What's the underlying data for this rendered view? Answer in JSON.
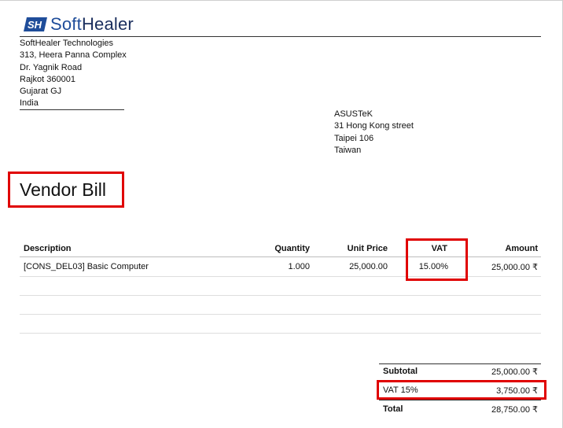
{
  "logo": {
    "mark": "SH",
    "name_part1": "Soft",
    "name_part2": "Healer"
  },
  "company": {
    "lines": [
      "SoftHealer Technologies",
      "313, Heera Panna Complex",
      "Dr. Yagnik Road",
      "Rajkot 360001",
      "Gujarat GJ",
      "India"
    ]
  },
  "vendor": {
    "lines": [
      "ASUSTeK",
      "31 Hong Kong street",
      "Taipei 106",
      "Taiwan"
    ]
  },
  "document_title": "Vendor Bill",
  "table": {
    "headers": {
      "description": "Description",
      "quantity": "Quantity",
      "unit_price": "Unit Price",
      "vat": "VAT",
      "amount": "Amount"
    },
    "rows": [
      {
        "description": "[CONS_DEL03] Basic Computer",
        "quantity": "1.000",
        "unit_price": "25,000.00",
        "vat": "15.00%",
        "amount": "25,000.00 ₹"
      }
    ]
  },
  "totals": {
    "subtotal_label": "Subtotal",
    "subtotal_value": "25,000.00 ₹",
    "vat_label": "VAT 15%",
    "vat_value": "3,750.00 ₹",
    "total_label": "Total",
    "total_value": "28,750.00 ₹"
  },
  "colors": {
    "highlight": "#e00000",
    "logo_blue": "#1f4d9a",
    "logo_dark": "#1b2f5e"
  }
}
